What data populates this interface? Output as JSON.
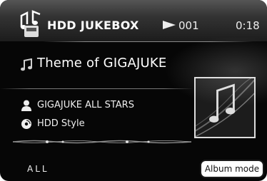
{
  "header": {
    "app_title": "HDD JUKEBOX",
    "track_number": "001",
    "elapsed_time": "0:18",
    "icons": [
      "jukebox-notes-icon",
      "play-icon"
    ]
  },
  "now_playing": {
    "title": "Theme of GIGAJUKE",
    "artist": "GIGAJUKE ALL STARS",
    "album": "HDD Style",
    "icons": [
      "music-note-icon",
      "artist-person-icon",
      "album-disc-icon",
      "album-art-icon"
    ]
  },
  "footer": {
    "scope_label": "ALL",
    "album_mode_label": "Album mode"
  }
}
